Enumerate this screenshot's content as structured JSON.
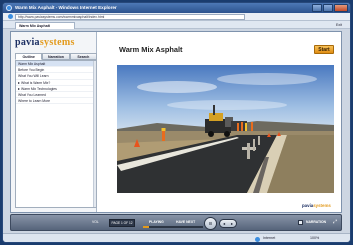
{
  "window": {
    "title": "Warm Mix Asphalt - Windows Internet Explorer",
    "address": "http://www.paviasystems.com/warmmixasphalt/index.html",
    "tab_label": "Warm Mix Asphalt",
    "exit_label": "Exit"
  },
  "sidebar": {
    "logo_part1": "pavia",
    "logo_part2": "systems",
    "tabs": [
      {
        "label": "Outline"
      },
      {
        "label": "Narration"
      },
      {
        "label": "Search"
      }
    ],
    "outline": [
      {
        "label": "Warm Mix Asphalt",
        "selected": true,
        "expandable": false
      },
      {
        "label": "Before You Begin",
        "selected": false,
        "expandable": false
      },
      {
        "label": "What You Will Learn",
        "selected": false,
        "expandable": false
      },
      {
        "label": "What is Warm Mix?",
        "selected": false,
        "expandable": true
      },
      {
        "label": "Warm Mix Technologies",
        "selected": false,
        "expandable": true
      },
      {
        "label": "What You Learned",
        "selected": false,
        "expandable": false
      },
      {
        "label": "Where to Learn More",
        "selected": false,
        "expandable": false
      }
    ]
  },
  "slide": {
    "title": "Warm Mix Asphalt",
    "start_label": "Start",
    "photo_icon": "paving-crew-photo",
    "footer_logo_part1": "pavia",
    "footer_logo_part2": "systems"
  },
  "controls": {
    "volume_label": "VOL",
    "page_label": "PAGE 1 OF 12",
    "status_label": "PLAYING",
    "next_label": "HAVE NEXT",
    "progress": 0.1,
    "pause_glyph": "II",
    "prev_glyph": "◄",
    "next_glyph": "►",
    "narration_label": "NARRATION",
    "fullscreen_glyph": "⤢"
  },
  "statusbar": {
    "zone_label": "Internet",
    "zoom_label": "100%"
  },
  "colors": {
    "brand_navy": "#1c2f63",
    "brand_orange": "#e39a1c",
    "frame_blue": "#1a3c6e"
  }
}
